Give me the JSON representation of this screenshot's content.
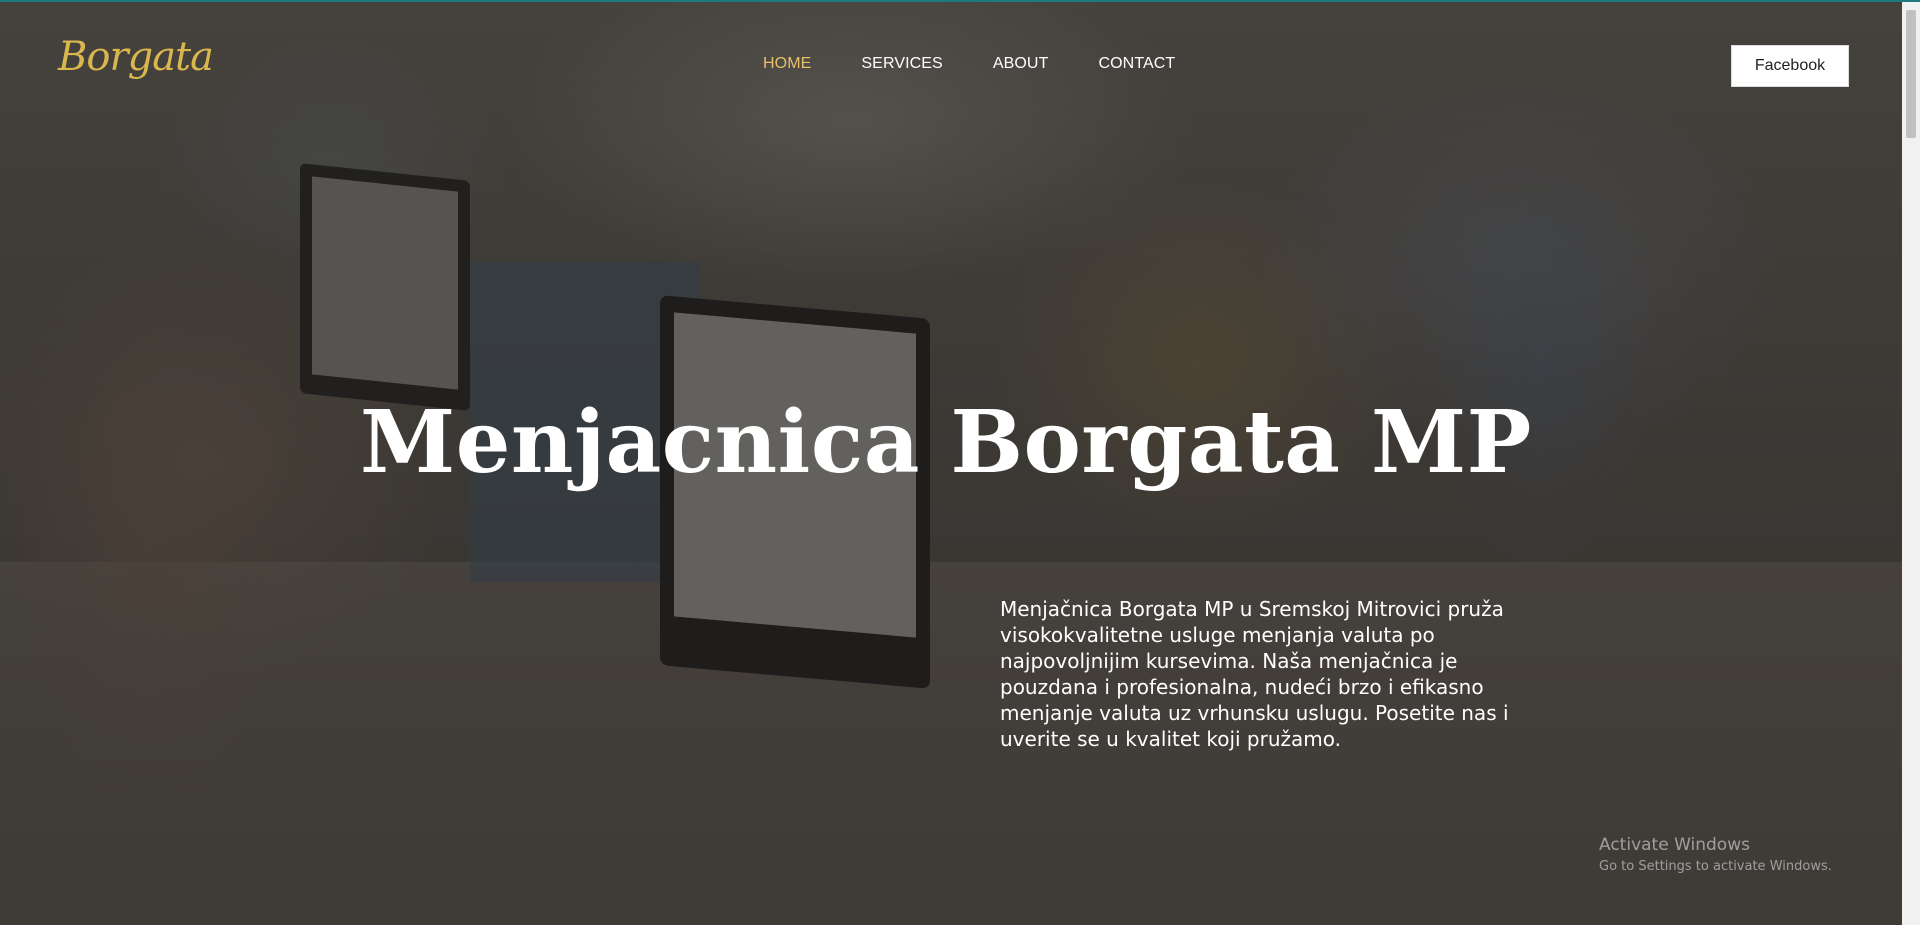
{
  "logo": {
    "text": "Borgata",
    "color": "#d9b64e"
  },
  "nav": {
    "items": [
      {
        "label": "HOME",
        "active": true
      },
      {
        "label": "SERVICES",
        "active": false
      },
      {
        "label": "ABOUT",
        "active": false
      },
      {
        "label": "CONTACT",
        "active": false
      }
    ],
    "active_color": "#e7c16a"
  },
  "facebook_button": {
    "label": "Facebook"
  },
  "hero": {
    "title": "Menjacnica Borgata MP",
    "description": "Menjačnica Borgata MP u Sremskoj Mitrovici pruža visokokvalitetne usluge menjanja valuta po najpovoljnijim kursevima. Naša menjačnica je pouzdana i profesionalna, nudeći brzo i efikasno menjanje valuta uz vrhunsku uslugu. Posetite nas i uverite se u kvalitet koji pružamo."
  },
  "watermark": {
    "title": "Activate Windows",
    "subtitle": "Go to Settings to activate Windows."
  }
}
